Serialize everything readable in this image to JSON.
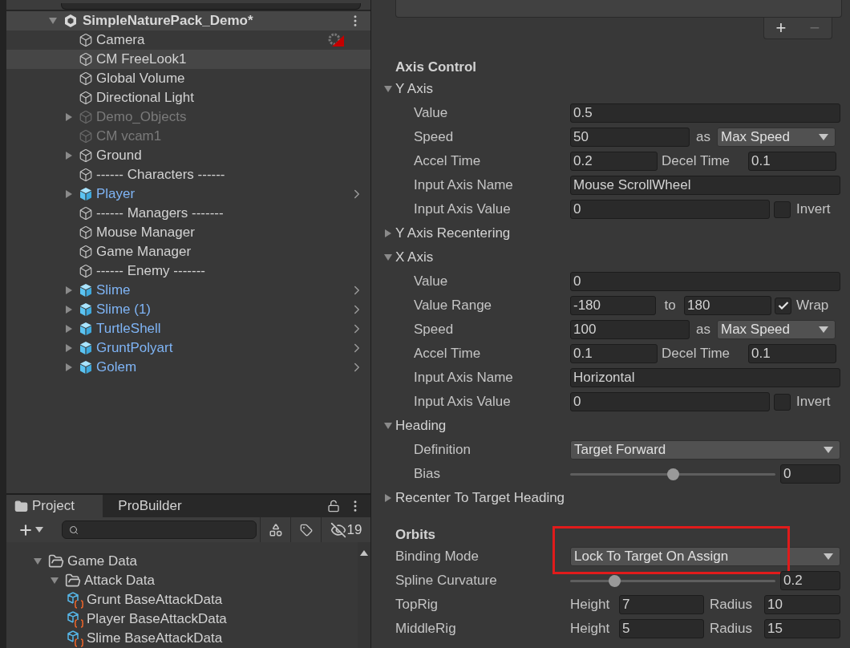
{
  "hierarchy": {
    "scene": {
      "name": "SimpleNaturePack_Demo*",
      "expanded": true
    },
    "items": [
      {
        "name": "Camera",
        "prefab": false,
        "disabled": false,
        "selected": false,
        "expandable": false,
        "warning": true
      },
      {
        "name": "CM FreeLook1",
        "prefab": false,
        "disabled": false,
        "selected": true,
        "expandable": false,
        "warning": false
      },
      {
        "name": "Global Volume",
        "prefab": false,
        "disabled": false,
        "selected": false,
        "expandable": false,
        "warning": false
      },
      {
        "name": "Directional Light",
        "prefab": false,
        "disabled": false,
        "selected": false,
        "expandable": false,
        "warning": false
      },
      {
        "name": "Demo_Objects",
        "prefab": false,
        "disabled": true,
        "selected": false,
        "expandable": true,
        "warning": false
      },
      {
        "name": "CM vcam1",
        "prefab": false,
        "disabled": true,
        "selected": false,
        "expandable": false,
        "warning": false
      },
      {
        "name": "Ground",
        "prefab": false,
        "disabled": false,
        "selected": false,
        "expandable": true,
        "warning": false
      },
      {
        "name": "------ Characters ------",
        "prefab": false,
        "disabled": false,
        "selected": false,
        "expandable": false,
        "warning": false
      },
      {
        "name": "Player",
        "prefab": true,
        "disabled": false,
        "selected": false,
        "expandable": true,
        "warning": false
      },
      {
        "name": "------ Managers -------",
        "prefab": false,
        "disabled": false,
        "selected": false,
        "expandable": false,
        "warning": false
      },
      {
        "name": "Mouse Manager",
        "prefab": false,
        "disabled": false,
        "selected": false,
        "expandable": false,
        "warning": false
      },
      {
        "name": "Game Manager",
        "prefab": false,
        "disabled": false,
        "selected": false,
        "expandable": false,
        "warning": false
      },
      {
        "name": "------ Enemy -------",
        "prefab": false,
        "disabled": false,
        "selected": false,
        "expandable": false,
        "warning": false
      },
      {
        "name": "Slime",
        "prefab": true,
        "disabled": false,
        "selected": false,
        "expandable": true,
        "warning": false
      },
      {
        "name": "Slime (1)",
        "prefab": true,
        "disabled": false,
        "selected": false,
        "expandable": true,
        "warning": false
      },
      {
        "name": "TurtleShell",
        "prefab": true,
        "disabled": false,
        "selected": false,
        "expandable": true,
        "warning": false
      },
      {
        "name": "GruntPolyart",
        "prefab": true,
        "disabled": false,
        "selected": false,
        "expandable": true,
        "warning": false
      },
      {
        "name": "Golem",
        "prefab": true,
        "disabled": false,
        "selected": false,
        "expandable": true,
        "warning": false
      }
    ]
  },
  "project": {
    "tabs": [
      {
        "label": "Project",
        "selected": true
      },
      {
        "label": "ProBuilder",
        "selected": false
      }
    ],
    "hidden_count": "19",
    "tree": [
      {
        "name": "Game Data",
        "expanded": true,
        "children": [
          {
            "name": "Attack Data",
            "expanded": true,
            "children": [
              {
                "name": "Grunt BaseAttackData"
              },
              {
                "name": "Player BaseAttackData"
              },
              {
                "name": "Slime BaseAttackData"
              }
            ]
          }
        ]
      }
    ]
  },
  "inspector": {
    "list_buttons": [
      {
        "label": "+",
        "disabled": false
      },
      {
        "label": "−",
        "disabled": true
      }
    ],
    "sections": [
      {
        "title": "Axis Control",
        "items": [
          {
            "kind": "foldout",
            "label": "Y Axis",
            "expanded": true,
            "children": [
              {
                "kind": "field",
                "label": "Value",
                "value": "0.5"
              },
              {
                "kind": "speed",
                "label": "Speed",
                "value": "50",
                "joiner": "as",
                "option": "Max Speed"
              },
              {
                "kind": "pair",
                "label": "Accel Time",
                "value": "0.2",
                "label2": "Decel Time",
                "value2": "0.1"
              },
              {
                "kind": "field",
                "label": "Input Axis Name",
                "value": "Mouse ScrollWheel"
              },
              {
                "kind": "invert",
                "label": "Input Axis Value",
                "value": "0",
                "toggle": {
                  "label": "Invert",
                  "checked": false
                }
              }
            ]
          },
          {
            "kind": "foldout",
            "label": "Y Axis Recentering",
            "expanded": false
          },
          {
            "kind": "foldout",
            "label": "X Axis",
            "expanded": true,
            "children": [
              {
                "kind": "field",
                "label": "Value",
                "value": "0"
              },
              {
                "kind": "range",
                "label": "Value Range",
                "value": "-180",
                "joiner": "to",
                "value2": "180",
                "toggle": {
                  "label": "Wrap",
                  "checked": true
                }
              },
              {
                "kind": "speed",
                "label": "Speed",
                "value": "100",
                "joiner": "as",
                "option": "Max Speed"
              },
              {
                "kind": "pair",
                "label": "Accel Time",
                "value": "0.1",
                "label2": "Decel Time",
                "value2": "0.1"
              },
              {
                "kind": "field",
                "label": "Input Axis Name",
                "value": "Horizontal"
              },
              {
                "kind": "invert",
                "label": "Input Axis Value",
                "value": "0",
                "toggle": {
                  "label": "Invert",
                  "checked": false
                }
              }
            ]
          },
          {
            "kind": "foldout",
            "label": "Heading",
            "expanded": true,
            "children": [
              {
                "kind": "dropdown",
                "label": "Definition",
                "option": "Target Forward"
              },
              {
                "kind": "slider",
                "label": "Bias",
                "level": 0.5,
                "value": "0"
              }
            ]
          },
          {
            "kind": "foldout",
            "label": "Recenter To Target Heading",
            "expanded": false
          }
        ]
      },
      {
        "title": "Orbits",
        "items": [
          {
            "kind": "dropdown",
            "label": "Binding Mode",
            "option": "Lock To Target On Assign",
            "highlighted": true
          },
          {
            "kind": "slider",
            "label": "Spline Curvature",
            "level": 0.2,
            "value": "0.2"
          },
          {
            "kind": "rig",
            "label": "TopRig",
            "label2": "Height",
            "value": "7",
            "label3": "Radius",
            "value2": "10"
          },
          {
            "kind": "rig",
            "label": "MiddleRig",
            "label2": "Height",
            "value": "5",
            "label3": "Radius",
            "value2": "15"
          }
        ]
      }
    ]
  }
}
